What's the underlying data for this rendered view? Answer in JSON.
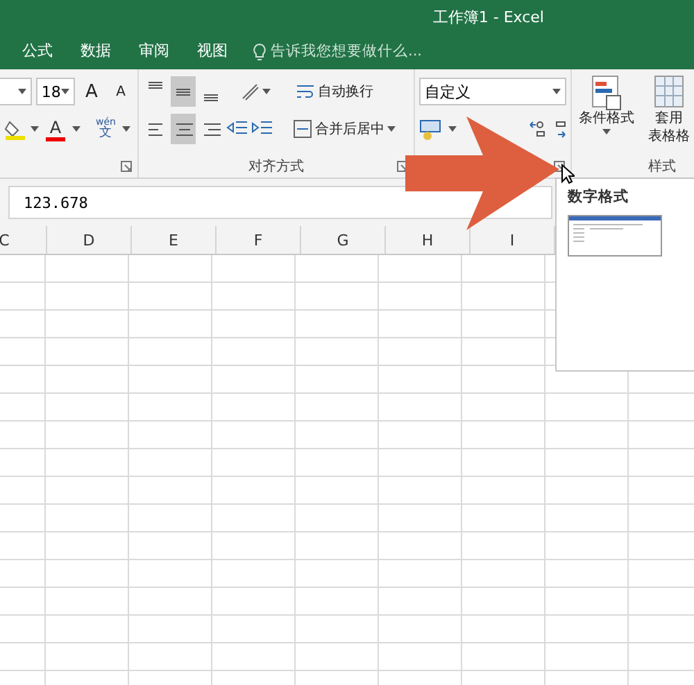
{
  "window": {
    "title": "工作簿1 - Excel"
  },
  "menu": {
    "tabs": [
      {
        "label": "公式",
        "selected": false
      },
      {
        "label": "数据",
        "selected": false
      },
      {
        "label": "审阅",
        "selected": false
      },
      {
        "label": "视图",
        "selected": false
      }
    ],
    "tell_me": {
      "placeholder": "告诉我您想要做什么..."
    }
  },
  "ribbon": {
    "font": {
      "size": "18",
      "grow": "A",
      "shrink": "A",
      "font_color": "A",
      "phonetic_top": "wén",
      "phonetic_bottom": "文"
    },
    "alignment": {
      "label": "对齐方式",
      "vertical": [
        {
          "kind": "top",
          "selected": false
        },
        {
          "kind": "middle",
          "selected": true
        },
        {
          "kind": "bottom",
          "selected": false
        }
      ],
      "horizontal": [
        {
          "kind": "left",
          "selected": false
        },
        {
          "kind": "center",
          "selected": true
        },
        {
          "kind": "right",
          "selected": false
        }
      ],
      "wrap": "自动换行",
      "merge": "合并后居中"
    },
    "number": {
      "format": "自定义"
    },
    "styles": {
      "label": "样式",
      "conditional": "条件格式",
      "table_top": "套用",
      "table_bottom": "表格格"
    }
  },
  "formula_bar": {
    "value": "123.678"
  },
  "columns": [
    "C",
    "D",
    "E",
    "F",
    "G",
    "H",
    "I"
  ],
  "tooltip": {
    "title": "数字格式"
  }
}
